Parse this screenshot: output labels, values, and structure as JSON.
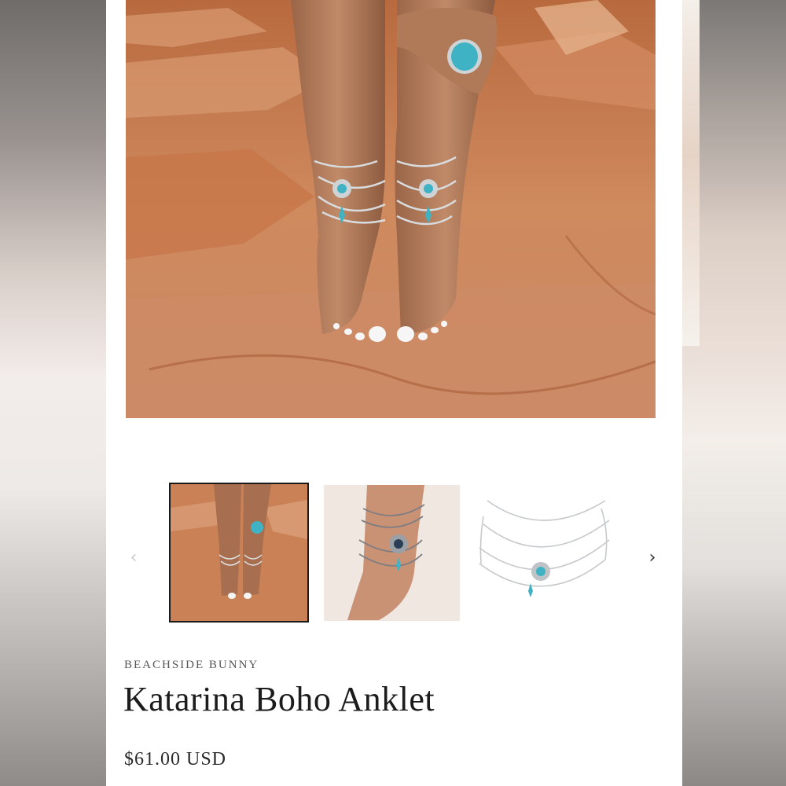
{
  "product": {
    "vendor": "BEACHSIDE BUNNY",
    "title": "Katarina Boho Anklet",
    "price": "$61.00 USD"
  },
  "gallery": {
    "prev_icon": "chevron-left-icon",
    "next_icon": "chevron-right-icon",
    "selected_index": 0,
    "thumbnail_count": 3
  },
  "colors": {
    "rock": "#c97b4f",
    "turquoise": "#3fb3c4",
    "silver": "#d9dcdf",
    "selected_border": "#1a1a1a"
  }
}
